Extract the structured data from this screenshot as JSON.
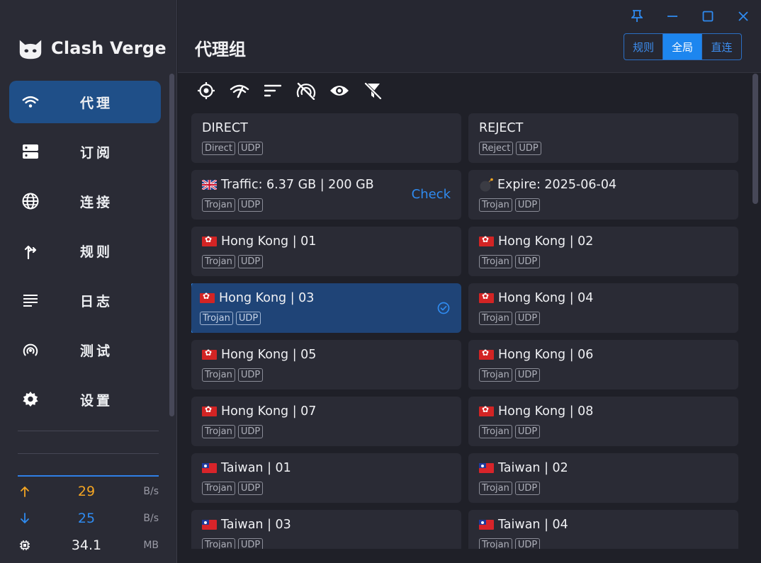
{
  "app": {
    "name": "Clash Verge"
  },
  "sidebar": {
    "items": [
      {
        "label": "代理",
        "icon": "wifi-icon",
        "active": true
      },
      {
        "label": "订阅",
        "icon": "storage-icon",
        "active": false
      },
      {
        "label": "连接",
        "icon": "globe-icon",
        "active": false
      },
      {
        "label": "规则",
        "icon": "fork-arrow-icon",
        "active": false
      },
      {
        "label": "日志",
        "icon": "lines-icon",
        "active": false
      },
      {
        "label": "测试",
        "icon": "radar-icon",
        "active": false
      },
      {
        "label": "设置",
        "icon": "gear-icon",
        "active": false
      }
    ]
  },
  "stats": {
    "upload": {
      "value": "29",
      "unit": "B/s",
      "color": "#f5a623"
    },
    "download": {
      "value": "25",
      "unit": "B/s",
      "color": "#2f8bf0"
    },
    "memory": {
      "value": "34.1",
      "unit": "MB"
    }
  },
  "header": {
    "title": "代理组",
    "modes": [
      {
        "label": "规则",
        "active": false
      },
      {
        "label": "全局",
        "active": true
      },
      {
        "label": "直连",
        "active": false
      }
    ]
  },
  "toolbar": {
    "icons": [
      "locate-icon",
      "speed-test-icon",
      "sort-icon",
      "no-latency-icon",
      "eye-icon",
      "filter-off-icon"
    ]
  },
  "proxies": [
    {
      "name": "DIRECT",
      "flag": "",
      "tags": [
        "Direct",
        "UDP"
      ]
    },
    {
      "name": "REJECT",
      "flag": "",
      "tags": [
        "Reject",
        "UDP"
      ]
    },
    {
      "name": "Traffic: 6.37 GB | 200 GB",
      "flag": "uk",
      "tags": [
        "Trojan",
        "UDP"
      ],
      "action": "Check"
    },
    {
      "name": "Expire: 2025-06-04",
      "flag": "bomb",
      "tags": [
        "Trojan",
        "UDP"
      ]
    },
    {
      "name": "Hong Kong | 01",
      "flag": "hk",
      "tags": [
        "Trojan",
        "UDP"
      ]
    },
    {
      "name": "Hong Kong | 02",
      "flag": "hk",
      "tags": [
        "Trojan",
        "UDP"
      ]
    },
    {
      "name": "Hong Kong | 03",
      "flag": "hk",
      "tags": [
        "Trojan",
        "UDP"
      ],
      "selected": true
    },
    {
      "name": "Hong Kong | 04",
      "flag": "hk",
      "tags": [
        "Trojan",
        "UDP"
      ]
    },
    {
      "name": "Hong Kong | 05",
      "flag": "hk",
      "tags": [
        "Trojan",
        "UDP"
      ]
    },
    {
      "name": "Hong Kong | 06",
      "flag": "hk",
      "tags": [
        "Trojan",
        "UDP"
      ]
    },
    {
      "name": "Hong Kong | 07",
      "flag": "hk",
      "tags": [
        "Trojan",
        "UDP"
      ]
    },
    {
      "name": "Hong Kong | 08",
      "flag": "hk",
      "tags": [
        "Trojan",
        "UDP"
      ]
    },
    {
      "name": "Taiwan | 01",
      "flag": "tw",
      "tags": [
        "Trojan",
        "UDP"
      ]
    },
    {
      "name": "Taiwan | 02",
      "flag": "tw",
      "tags": [
        "Trojan",
        "UDP"
      ]
    },
    {
      "name": "Taiwan | 03",
      "flag": "tw",
      "tags": [
        "Trojan",
        "UDP"
      ]
    },
    {
      "name": "Taiwan | 04",
      "flag": "tw",
      "tags": [
        "Trojan",
        "UDP"
      ]
    }
  ],
  "colors": {
    "accent": "#2f8bf0",
    "selected_bg": "#1f4477",
    "card_bg": "#2a2b35"
  }
}
